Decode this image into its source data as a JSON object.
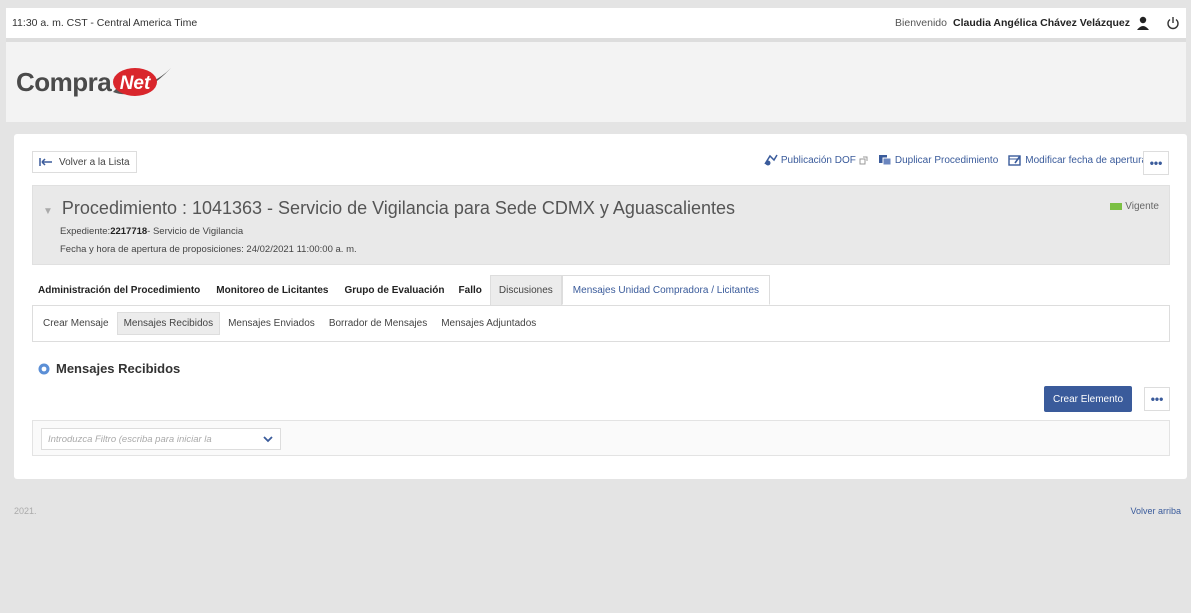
{
  "topbar": {
    "time": "11:30 a. m. CST - Central America Time",
    "welcome": "Bienvenido",
    "user_name": "Claudia Angélica Chávez Velázquez"
  },
  "logo": {
    "compra": "Compra",
    "net": "Net"
  },
  "back_label": "Volver a la Lista",
  "actions": {
    "publicacion": "Publicación DOF",
    "duplicar": "Duplicar Procedimiento",
    "modificar": "Modificar fecha de apertura",
    "more": "•••"
  },
  "procedimiento": {
    "title": "Procedimiento : 1041363 - Servicio de Vigilancia para Sede CDMX y Aguascalientes",
    "expediente_label": "Expediente:",
    "expediente_num": "2217718",
    "expediente_desc": "- Servicio de Vigilancia",
    "fecha": "Fecha y hora de apertura de proposiciones: 24/02/2021 11:00:00 a. m.",
    "status": "Vigente"
  },
  "tabs": [
    "Administración del Procedimiento",
    "Monitoreo de Licitantes",
    "Grupo de Evaluación",
    "Fallo",
    "Discusiones",
    "Mensajes Unidad Compradora / Licitantes"
  ],
  "subtabs": [
    "Crear Mensaje",
    "Mensajes Recibidos",
    "Mensajes Enviados",
    "Borrador de Mensajes",
    "Mensajes Adjuntados"
  ],
  "section_title": "Mensajes Recibidos",
  "crear_button": "Crear Elemento",
  "more_button": "•••",
  "filter_placeholder": "Introduzca Filtro (escriba para iniciar la",
  "footer": {
    "year": "2021.",
    "back_top": "Volver arriba"
  },
  "colors": {
    "accent": "#3a5b9b",
    "status": "#7bc043",
    "logo_red": "#d9262c"
  }
}
